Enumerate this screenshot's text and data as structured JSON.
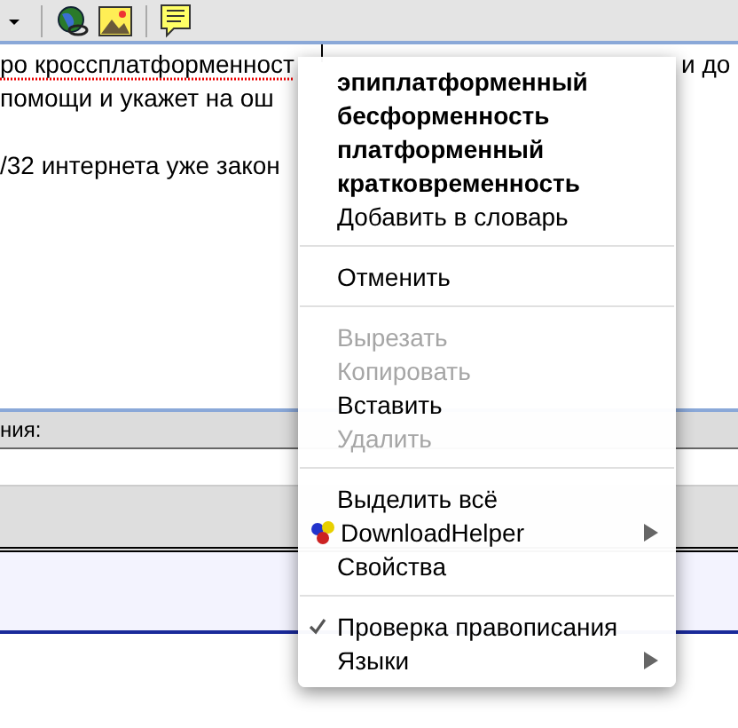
{
  "toolbar": {
    "buttons": [
      {
        "kind": "dropdown"
      },
      {
        "kind": "globe"
      },
      {
        "kind": "picture"
      },
      {
        "kind": "note"
      }
    ]
  },
  "editor": {
    "paragraphs": [
      [
        {
          "left": "ро кроссплатформенност",
          "misspelled": true,
          "right": "и до"
        },
        {
          "left": "помощи и укажет на ош",
          "misspelled": false
        }
      ],
      [
        {
          "left": "/32 интернета уже закон",
          "misspelled": false
        }
      ]
    ]
  },
  "form": {
    "label": "ния:"
  },
  "context_menu": {
    "items": [
      {
        "kind": "suggestion",
        "label": "эпиплатформенный"
      },
      {
        "kind": "suggestion",
        "label": "бесформенность"
      },
      {
        "kind": "suggestion",
        "label": "платформенный"
      },
      {
        "kind": "suggestion",
        "label": "кратковременность"
      },
      {
        "kind": "command",
        "label": "Добавить в словарь",
        "disabled": false,
        "checked": false,
        "submenu": false
      },
      {
        "kind": "separator"
      },
      {
        "kind": "command",
        "label": "Отменить",
        "disabled": false,
        "checked": false,
        "submenu": false
      },
      {
        "kind": "separator"
      },
      {
        "kind": "command",
        "label": "Вырезать",
        "disabled": true,
        "checked": false,
        "submenu": false
      },
      {
        "kind": "command",
        "label": "Копировать",
        "disabled": true,
        "checked": false,
        "submenu": false
      },
      {
        "kind": "command",
        "label": "Вставить",
        "disabled": false,
        "checked": false,
        "submenu": false
      },
      {
        "kind": "command",
        "label": "Удалить",
        "disabled": true,
        "checked": false,
        "submenu": false
      },
      {
        "kind": "separator"
      },
      {
        "kind": "command",
        "label": "Выделить всё",
        "disabled": false,
        "checked": false,
        "submenu": false
      },
      {
        "kind": "extension",
        "label": "DownloadHelper",
        "disabled": false,
        "checked": false,
        "submenu": true
      },
      {
        "kind": "command",
        "label": "Свойства",
        "disabled": false,
        "checked": false,
        "submenu": false
      },
      {
        "kind": "separator"
      },
      {
        "kind": "command",
        "label": "Проверка правописания",
        "disabled": false,
        "checked": true,
        "submenu": false
      },
      {
        "kind": "command",
        "label": "Языки",
        "disabled": false,
        "checked": false,
        "submenu": true
      }
    ]
  }
}
